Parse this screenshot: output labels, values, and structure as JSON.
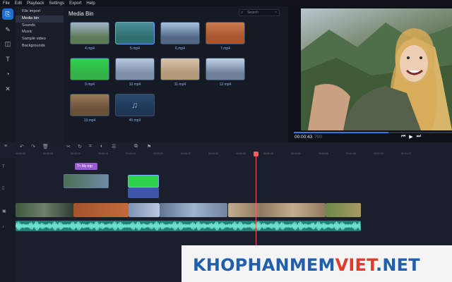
{
  "menu": [
    "File",
    "Edit",
    "Playback",
    "Settings",
    "Export",
    "Help"
  ],
  "rail_icons": [
    "import-icon",
    "filters-icon",
    "transitions-icon",
    "titles-icon",
    "stickers-icon",
    "tools-icon"
  ],
  "categories": [
    "File import",
    "Media bin",
    "Sounds",
    "Music",
    "Sample video",
    "Backgrounds"
  ],
  "selected_category": 1,
  "media_bin": {
    "title": "Media Bin",
    "search_placeholder": "Search",
    "items": [
      {
        "label": "4.mp4",
        "color": "#5c7a54",
        "sky": "#9fb4c8",
        "selected": false
      },
      {
        "label": "5.mp4",
        "color": "#2f6e6e",
        "sky": "#4a8f9a",
        "selected": true
      },
      {
        "label": "6.mp4",
        "color": "#516987",
        "sky": "#a9c3dc",
        "selected": false
      },
      {
        "label": "7.mp4",
        "color": "#a9552f",
        "sky": "#c97a4f",
        "selected": false
      },
      {
        "label": "9.mp4",
        "color": "#33b34a",
        "sky": "#2fd24d",
        "selected": false
      },
      {
        "label": "10.mp4",
        "color": "#7e8fa8",
        "sky": "#b8c8de",
        "selected": false
      },
      {
        "label": "11.mp4",
        "color": "#b39978",
        "sky": "#d8c6ad",
        "selected": false
      },
      {
        "label": "12.mp4",
        "color": "#6e7f9a",
        "sky": "#c2d3e6",
        "selected": false
      },
      {
        "label": "13.mp4",
        "color": "#6b5038",
        "sky": "#9a7a57",
        "selected": false
      },
      {
        "label": "45.mp3",
        "color": "#1e3654",
        "sky": "#2a4a70",
        "selected": false
      }
    ]
  },
  "preview": {
    "timecode": "00:00:43",
    "duration": "700",
    "progress": 0.6
  },
  "timeline": {
    "ruler_ticks": [
      "00:00:00",
      "00:00:05",
      "00:00:10",
      "00:00:15",
      "00:00:20",
      "00:00:25",
      "00:00:30",
      "00:00:35",
      "00:00:40",
      "00:00:45",
      "00:00:50",
      "00:00:55",
      "00:01:00",
      "00:01:05",
      "00:01:10"
    ],
    "title_clip": "My trip"
  },
  "watermark": {
    "part1": "KHOPHANMEM",
    "part2": "VIET",
    "part3": ".NET",
    "colors": [
      "#1f5fae",
      "#e23b2e",
      "#1f5fae"
    ]
  }
}
